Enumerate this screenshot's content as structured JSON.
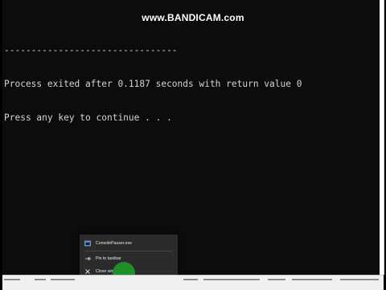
{
  "watermark": "www.BANDICAM.com",
  "console": {
    "lines": [
      "--------------------------------",
      "Process exited after 0.1187 seconds with return value 0",
      "Press any key to continue . . ."
    ]
  },
  "jumplist": {
    "app_item": "ConsolePauser.exe",
    "pin_item": "Pin to taskbar",
    "close_item": "Close window"
  },
  "colors": {
    "console_bg": "#0c0c0c",
    "console_text": "#d4d4d4",
    "menu_bg": "#2b2b2b",
    "cursor_highlight": "#1f8f2a"
  },
  "icons": {
    "app": "console-app-icon",
    "pin": "pin-icon",
    "close": "close-icon"
  }
}
